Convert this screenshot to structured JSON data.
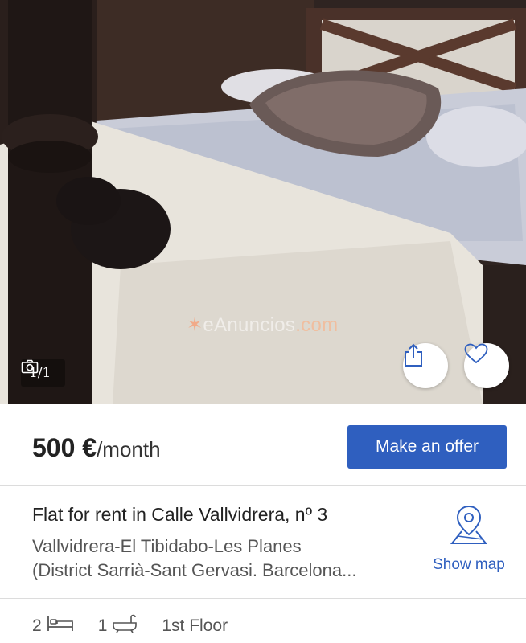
{
  "photo": {
    "counter": "1/1",
    "watermark_brand": "eAnuncios",
    "watermark_tld": ".com"
  },
  "icons": {
    "camera": "camera-icon",
    "share": "share-icon",
    "favorite": "heart-icon",
    "map": "map-pin-icon",
    "bed": "bed-icon",
    "bath": "bathtub-icon"
  },
  "listing": {
    "price": "500 €",
    "price_unit": "/month",
    "offer_label": "Make an offer",
    "title": "Flat for rent in Calle Vallvidrera, nº 3",
    "location_line1": "Vallvidrera-El Tibidabo-Les Planes",
    "location_line2": "(District Sarrià-Sant Gervasi. Barcelona...",
    "map_label": "Show map",
    "bedrooms": "2",
    "bathrooms": "1",
    "floor": "1st Floor"
  },
  "colors": {
    "accent": "#2f5fbf",
    "text": "#222222",
    "muted": "#555555"
  }
}
